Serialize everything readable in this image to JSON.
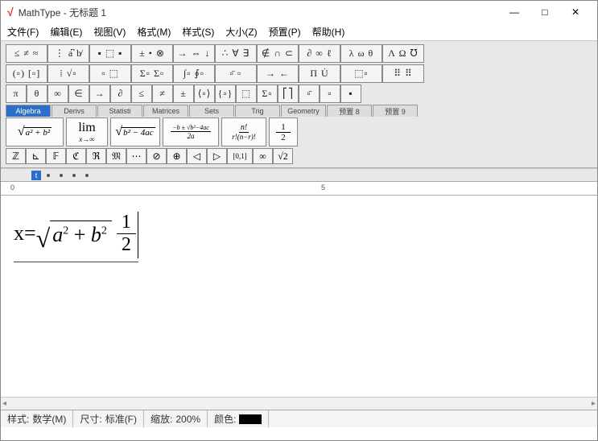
{
  "window": {
    "app_name": "MathType",
    "title_sep": " - ",
    "doc_name": "无标题 1",
    "min": "—",
    "max": "□",
    "close": "✕"
  },
  "menu": {
    "file": "文件(F)",
    "edit": "编辑(E)",
    "view": "视图(V)",
    "format": "格式(M)",
    "style": "样式(S)",
    "size": "大小(Z)",
    "preset": "预置(P)",
    "help": "帮助(H)"
  },
  "symrows": {
    "r1": [
      "≤ ≠ ≈",
      "⋮ a͆ b̸",
      "▪ ⬚ ▪",
      "± • ⊗",
      "→ ⇔ ↓",
      "∴ ∀ ∃",
      "∉ ∩ ⊂",
      "∂ ∞ ℓ",
      "λ ω θ",
      "Λ Ω ℧"
    ],
    "r2": [
      "(▫) [▫]",
      "⁞ √▫",
      "▫ ⬚",
      "Σ▫ Σ▫",
      "∫▫ ∮▫",
      "▫̄ ▫",
      "→ ←",
      "Π U̇",
      "⬚▫",
      "⠿ ⠿"
    ],
    "r3": [
      "π",
      "θ",
      "∞",
      "∈",
      "→",
      "∂",
      "≤",
      "≠",
      "±",
      "⟨▫⟩",
      "{▫}",
      "⬚",
      "Σ▫",
      "⎡⎤",
      "▫̄",
      "▫",
      "▪"
    ]
  },
  "tabs": {
    "algebra": "Algebra",
    "derivs": "Derivs",
    "statisti": "Statisti",
    "matrices": "Matrices",
    "sets": "Sets",
    "trig": "Trig",
    "geometry": "Geometry",
    "t8": "预置 8",
    "t9": "预置 9"
  },
  "templates": {
    "t1": {
      "body": "a² + b²"
    },
    "t2": {
      "top": "lim",
      "bot": "x→∞"
    },
    "t3": {
      "body": "b² − 4ac"
    },
    "t4": {
      "top": "−b ± √b²−4ac",
      "bot": "2a"
    },
    "t5": {
      "top": "n!",
      "bot": "r!(n−r)!"
    },
    "t6": {
      "top": "1",
      "bot": "2"
    }
  },
  "smallrow": [
    "ℤ",
    "⊾",
    "𝔽",
    "ℭ",
    "ℜ",
    "𝔐",
    "⋯",
    "⊘",
    "⊕",
    "◁",
    "▷",
    "[0,1]",
    "∞",
    "√2"
  ],
  "ruler": {
    "m0": "0",
    "m1": "5"
  },
  "equation": {
    "lhs": "x=",
    "rad_a": "a",
    "rad_p": "+",
    "rad_b": "b",
    "sq": "2",
    "f_num": "1",
    "f_den": "2"
  },
  "status": {
    "style_lbl": "样式:",
    "style_val": "数学(M)",
    "size_lbl": "尺寸:",
    "size_val": "标准(F)",
    "zoom_lbl": "缩放:",
    "zoom_val": "200%",
    "color_lbl": "颜色:"
  }
}
